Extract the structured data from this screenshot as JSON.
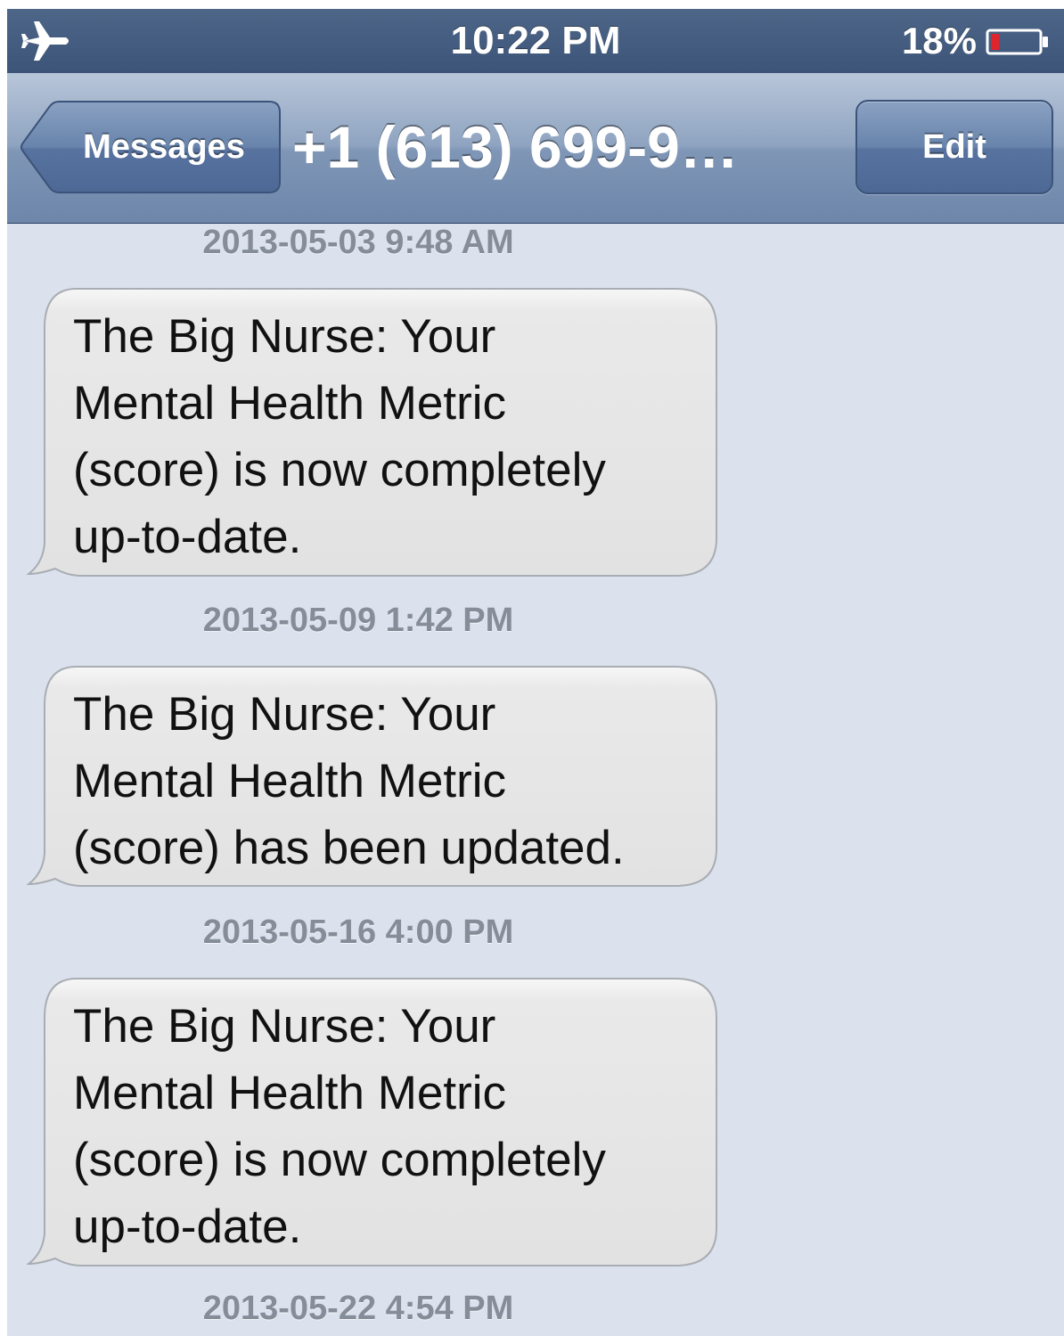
{
  "status_bar": {
    "mode_icon": "airplane-icon",
    "time": "10:22 PM",
    "battery_percent": "18%",
    "battery_icon": "battery-low-icon"
  },
  "nav_bar": {
    "back_label": "Messages",
    "title": "+1 (613) 699-9…",
    "edit_label": "Edit"
  },
  "colors": {
    "bubble_fill": "#e6e6e6",
    "background": "#dbe2ed",
    "nav_accent": "#6d86aa"
  },
  "messages": [
    {
      "timestamp": "2013-05-03 9:48 AM",
      "text": "The Big Nurse: Your\nMental Health Metric\n(score) is now completely\nup-to-date."
    },
    {
      "timestamp": "2013-05-09 1:42 PM",
      "text": "The Big Nurse: Your\nMental Health Metric\n(score) has been updated."
    },
    {
      "timestamp": "2013-05-16 4:00 PM",
      "text": "The Big Nurse: Your\nMental Health Metric\n(score) is now completely\nup-to-date."
    }
  ],
  "trailing_timestamp": "2013-05-22 4:54 PM"
}
